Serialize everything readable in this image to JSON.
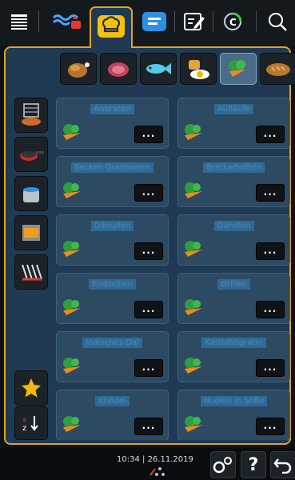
{
  "top_nav": {
    "icons": [
      "menu-icon",
      "cooking-modes-icon",
      "chef-hat-icon",
      "programs-list-icon",
      "edit-icon",
      "connected-cooking-icon",
      "search-icon"
    ]
  },
  "categories": [
    "poultry",
    "meat",
    "fish",
    "egg-dishes",
    "vegetables",
    "baked-goods"
  ],
  "selected_category": "vegetables",
  "left_buttons": [
    "grill-rack",
    "frying-pan",
    "pot",
    "baking-tray",
    "grill"
  ],
  "tiles": [
    {
      "label": "Anbraten"
    },
    {
      "label": "Aufläufe"
    },
    {
      "label": "Backen Gratinieren"
    },
    {
      "label": "Bratkartoffeln"
    },
    {
      "label": "Dämpfen"
    },
    {
      "label": "Dünsten"
    },
    {
      "label": "Einkochen"
    },
    {
      "label": "Grillen"
    },
    {
      "label": "Indisches Dal"
    },
    {
      "label": "Kartoffelgratin"
    },
    {
      "label": "Knödel"
    },
    {
      "label": "Nudeln in Soße"
    }
  ],
  "more_label": "...",
  "status": {
    "time": "10:34",
    "date": "26.11.2019"
  },
  "bottom": {
    "help": "?"
  },
  "colors": {
    "accent": "#e6a317",
    "panel": "#1f3a52",
    "tile": "#2d4a63"
  }
}
